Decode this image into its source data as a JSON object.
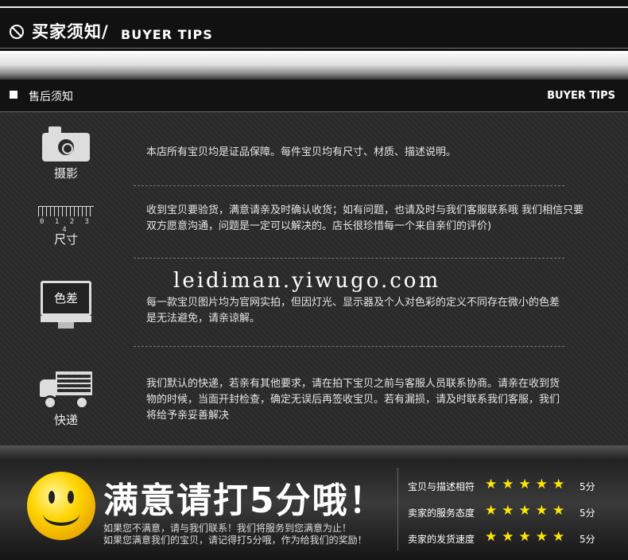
{
  "header": {
    "title": "买家须知/",
    "subtitle": "BUYER TIPS"
  },
  "section": {
    "title": "售后须知",
    "subtitle": "BUYER TIPS"
  },
  "items": [
    {
      "label": "摄影",
      "text": "本店所有宝贝均是证品保障。每件宝贝均有尺寸、材质、描述说明。"
    },
    {
      "label": "尺寸",
      "ruler_numbers": "0 1 2 3 4",
      "text": "收到宝贝要验货，满意请亲及时确认收货；如有问题，也请及时与我们客服联系哦 我们相信只要双方愿意沟通，问题是一定可以解决的。店长很珍惜每一个来自亲们的评价)"
    },
    {
      "label": "色差",
      "text": "每一款宝贝图片均为官网实拍，但因灯光、显示器及个人对色彩的定义不同存在微小的色差是无法避免，请亲谅解。"
    },
    {
      "label": "快递",
      "text": "我们默认的快递，若亲有其他要求，请在拍下宝贝之前与客服人员联系协商。请亲在收到货物的时候，当面开封检查，确定无误后再签收宝贝。若有漏损，请及时联系我们客服，我们将给予亲妥善解决"
    }
  ],
  "watermark": "leidiman.yiwugo.com",
  "bottom": {
    "headline": "满意请打5分哦！",
    "line1": "如果您不满意，请与我们联系！我们将服务到您满意为止！",
    "line2": "如果您满意我们的宝贝，请记得打5分哦，作为给我们的奖励！",
    "ratings": [
      {
        "label": "宝贝与描述相符",
        "stars": "★★★★★",
        "score": "5分"
      },
      {
        "label": "卖家的服务态度",
        "stars": "★★★★★",
        "score": "5分"
      },
      {
        "label": "卖家的发货速度",
        "stars": "★★★★★",
        "score": "5分"
      }
    ]
  }
}
